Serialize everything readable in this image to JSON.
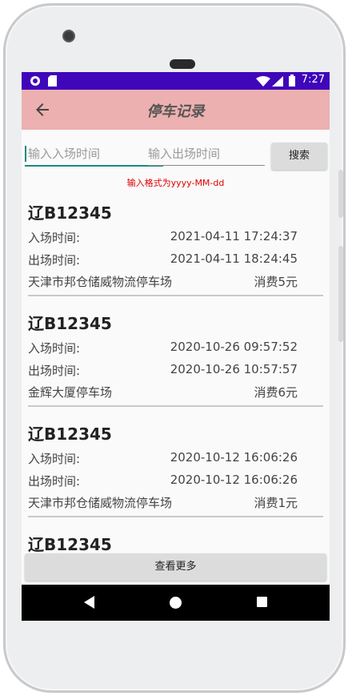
{
  "status_bar": {
    "time": "7:27"
  },
  "app_bar": {
    "title": "停车记录"
  },
  "filters": {
    "entry_placeholder": "输入入场时间",
    "exit_placeholder": "输入出场时间",
    "search_label": "搜索",
    "format_hint": "输入格式为yyyy-MM-dd"
  },
  "records": [
    {
      "plate": "辽B12345",
      "entry_label": "入场时间:",
      "entry_time": "2021-04-11 17:24:37",
      "exit_label": "出场时间:",
      "exit_time": "2021-04-11 18:24:45",
      "lot": "天津市邦仓储威物流停车场",
      "fee": "消费5元"
    },
    {
      "plate": "辽B12345",
      "entry_label": "入场时间:",
      "entry_time": "2020-10-26 09:57:52",
      "exit_label": "出场时间:",
      "exit_time": "2020-10-26 10:57:57",
      "lot": "金辉大厦停车场",
      "fee": "消费6元"
    },
    {
      "plate": "辽B12345",
      "entry_label": "入场时间:",
      "entry_time": "2020-10-12 16:06:26",
      "exit_label": "出场时间:",
      "exit_time": "2020-10-12 16:06:26",
      "lot": "天津市邦仓储威物流停车场",
      "fee": "消费1元"
    },
    {
      "plate": "辽B12345"
    }
  ],
  "more_button": "查看更多",
  "icons": {
    "back": "arrow-left-icon",
    "wifi": "wifi-icon",
    "signal": "signal-icon",
    "battery": "battery-icon"
  },
  "colors": {
    "status_bar": "#3f06ba",
    "app_bar": "#ecb0b0",
    "accent": "#1a8a80",
    "hint": "#e00000"
  }
}
